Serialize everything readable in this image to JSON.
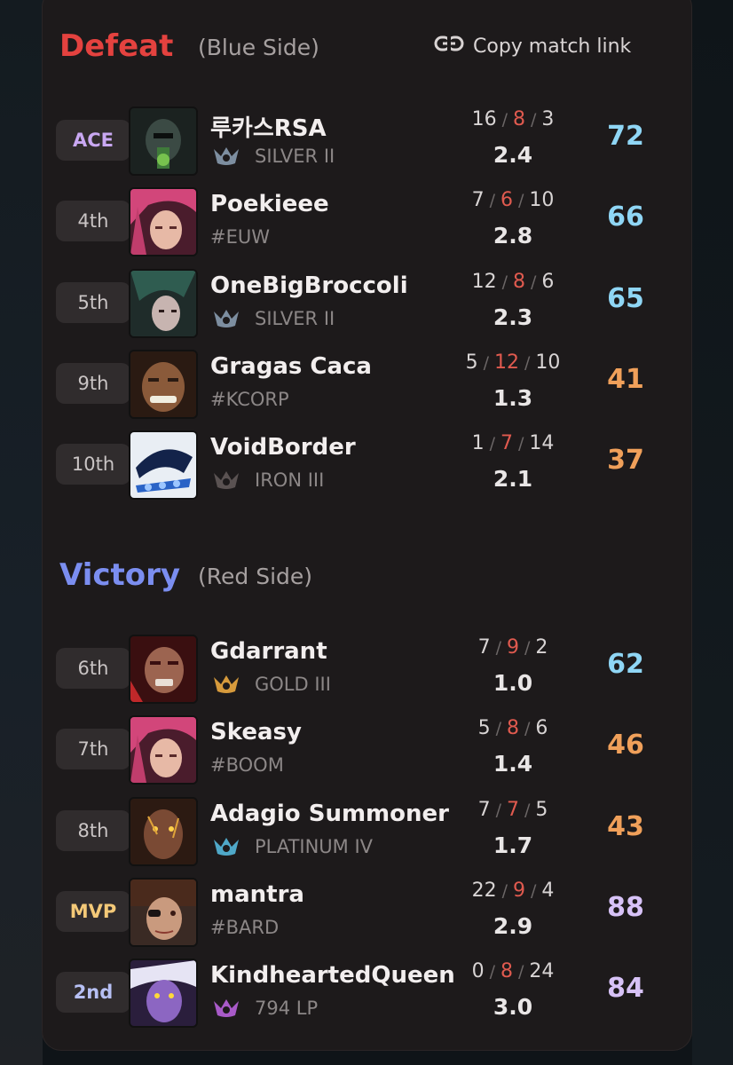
{
  "header": {
    "result": "Defeat",
    "side": "(Blue Side)",
    "copy_label": "Copy match link",
    "result_color": "#e4423f"
  },
  "victory_header": {
    "result": "Victory",
    "side": "(Red Side)",
    "result_color": "#7b8ef0"
  },
  "colors": {
    "score_blue": "#8fd6f5",
    "score_orange": "#f0a05a",
    "score_purple": "#d7c2f7",
    "ace_text": "#c9a8f2",
    "mvp_text": "#f4c978",
    "second_text": "#b7c0f4",
    "death_red": "#e05a4f"
  },
  "defeat_players": [
    {
      "placement": "ACE",
      "name": "루카스RSA",
      "sub": "SILVER II",
      "sub_type": "rank",
      "rank_icon": "silver-rank-icon",
      "kills": "16",
      "deaths": "8",
      "assists": "3",
      "kda": "2.4",
      "score": "72",
      "score_color": "#8fd6f5",
      "avatar": "champion-avatar-dark-knight"
    },
    {
      "placement": "4th",
      "name": "Poekieee",
      "sub": "#EUW",
      "sub_type": "tag",
      "kills": "7",
      "deaths": "6",
      "assists": "10",
      "kda": "2.8",
      "score": "66",
      "score_color": "#8fd6f5",
      "avatar": "champion-avatar-pink-hair"
    },
    {
      "placement": "5th",
      "name": "OneBigBroccoli",
      "sub": "SILVER II",
      "sub_type": "rank",
      "rank_icon": "silver-rank-icon",
      "kills": "12",
      "deaths": "8",
      "assists": "6",
      "kda": "2.3",
      "score": "65",
      "score_color": "#8fd6f5",
      "avatar": "champion-avatar-green-hair"
    },
    {
      "placement": "9th",
      "name": "Gragas Caca",
      "sub": "#KCORP",
      "sub_type": "tag",
      "kills": "5",
      "deaths": "12",
      "assists": "10",
      "kda": "1.3",
      "score": "41",
      "score_color": "#f0a05a",
      "avatar": "champion-avatar-grinning"
    },
    {
      "placement": "10th",
      "name": "VoidBorder",
      "sub": "IRON III",
      "sub_type": "rank",
      "rank_icon": "iron-rank-icon",
      "kills": "1",
      "deaths": "7",
      "assists": "14",
      "kda": "2.1",
      "score": "37",
      "score_color": "#f0a05a",
      "avatar": "champion-avatar-blue-chain"
    }
  ],
  "victory_players": [
    {
      "placement": "6th",
      "name": "Gdarrant",
      "sub": "GOLD III",
      "sub_type": "rank",
      "rank_icon": "gold-rank-icon",
      "kills": "7",
      "deaths": "9",
      "assists": "2",
      "kda": "1.0",
      "score": "62",
      "score_color": "#8fd6f5",
      "avatar": "champion-avatar-red-warrior"
    },
    {
      "placement": "7th",
      "name": "Skeasy",
      "sub": "#BOOM",
      "sub_type": "tag",
      "kills": "5",
      "deaths": "8",
      "assists": "6",
      "kda": "1.4",
      "score": "46",
      "score_color": "#f0a05a",
      "avatar": "champion-avatar-pink-hair"
    },
    {
      "placement": "8th",
      "name": "Adagio Summoner",
      "sub": "PLATINUM IV",
      "sub_type": "rank",
      "rank_icon": "platinum-rank-icon",
      "kills": "7",
      "deaths": "7",
      "assists": "5",
      "kda": "1.7",
      "score": "43",
      "score_color": "#f0a05a",
      "avatar": "champion-avatar-golden-eyes"
    },
    {
      "placement": "MVP",
      "name": "mantra",
      "sub": "#BARD",
      "sub_type": "tag",
      "kills": "22",
      "deaths": "9",
      "assists": "4",
      "kda": "2.9",
      "score": "88",
      "score_color": "#d7c2f7",
      "avatar": "champion-avatar-eyepatch"
    },
    {
      "placement": "2nd",
      "name": "KindheartedQueen",
      "sub": "794 LP",
      "sub_type": "rank",
      "rank_icon": "master-rank-icon",
      "kills": "0",
      "deaths": "8",
      "assists": "24",
      "kda": "3.0",
      "score": "84",
      "score_color": "#d7c2f7",
      "avatar": "champion-avatar-purple-skin"
    }
  ]
}
